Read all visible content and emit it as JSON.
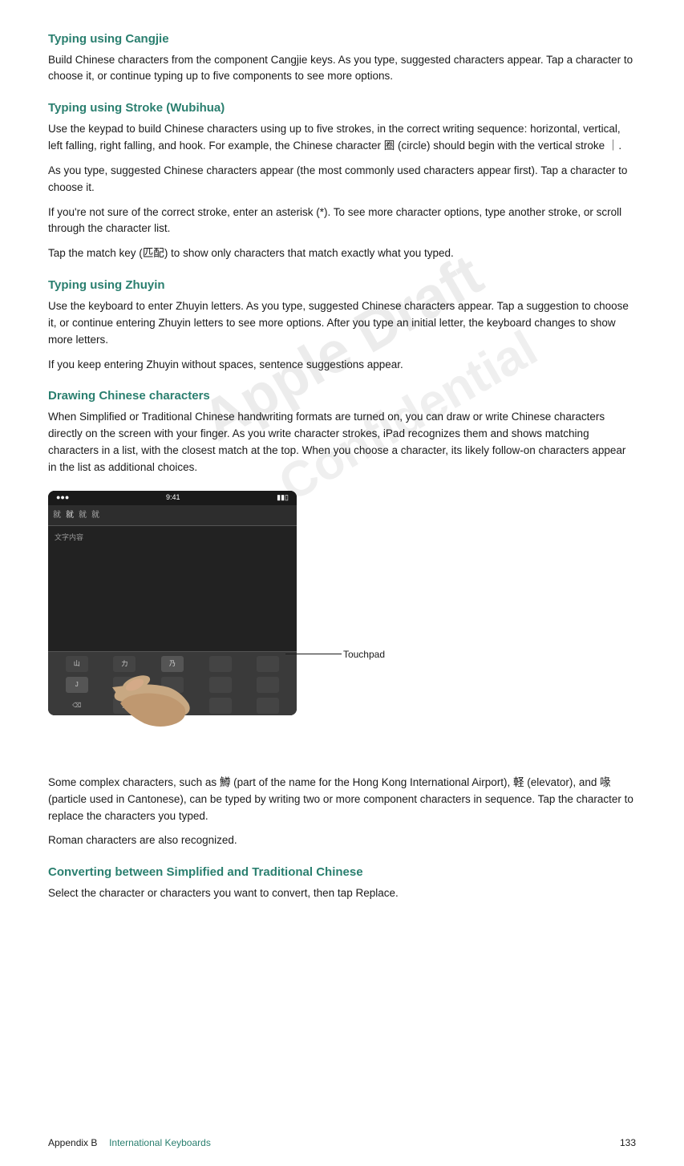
{
  "sections": [
    {
      "id": "typing-cangjie",
      "heading": "Typing using Cangjie",
      "paragraphs": [
        "Build Chinese characters from the component Cangjie keys. As you type, suggested characters appear. Tap a character to choose it, or continue typing up to five components to see more options."
      ]
    },
    {
      "id": "typing-stroke",
      "heading": "Typing using Stroke (Wubihua)",
      "paragraphs": [
        "Use the keypad to build Chinese characters using up to five strokes, in the correct writing sequence: horizontal, vertical, left falling, right falling, and hook. For example, the Chinese character 圈 (circle) should begin with the vertical stroke ｜.",
        "As you type, suggested Chinese characters appear (the most commonly used characters appear first). Tap a character to choose it.",
        "If you're not sure of the correct stroke, enter an asterisk (*). To see more character options, type another stroke, or scroll through the character list.",
        "Tap the match key (匹配) to show only characters that match exactly what you typed."
      ]
    },
    {
      "id": "typing-zhuyin",
      "heading": "Typing using Zhuyin",
      "paragraphs": [
        "Use the keyboard to enter Zhuyin letters. As you type, suggested Chinese characters appear. Tap a suggestion to choose it, or continue entering Zhuyin letters to see more options. After you type an initial letter, the keyboard changes to show more letters.",
        "If you keep entering Zhuyin without spaces, sentence suggestions appear."
      ]
    },
    {
      "id": "drawing-chinese",
      "heading": "Drawing Chinese characters",
      "paragraphs": [
        "When Simplified or Traditional Chinese handwriting formats are turned on, you can draw or write Chinese characters directly on the screen with your finger. As you write character strokes, iPad recognizes them and shows matching characters in a list, with the closest match at the top. When you choose a character, its likely follow-on characters appear in the list as additional choices.",
        "IPAD_IMAGE_PLACEHOLDER",
        "Some complex characters, such as 鱒 (part of the name for the Hong Kong International Airport), 軽 (elevator), and 喙 (particle used in Cantonese), can be typed by writing two or more component characters in sequence. Tap the character to replace the characters you typed.",
        "Roman characters are also recognized."
      ]
    },
    {
      "id": "converting-chinese",
      "heading": "Converting between Simplified and Traditional Chinese",
      "paragraphs": [
        "Select the character or characters you want to convert, then tap Replace."
      ]
    }
  ],
  "touchpad_label": "Touchpad",
  "watermark1": "Apple Draft",
  "watermark2": "Apple Confidential",
  "footer": {
    "appendix_label": "Appendix B",
    "section_label": "International Keyboards",
    "page_number": "133"
  },
  "image": {
    "alt": "iPad showing Chinese handwriting character recognition with touchpad area"
  }
}
